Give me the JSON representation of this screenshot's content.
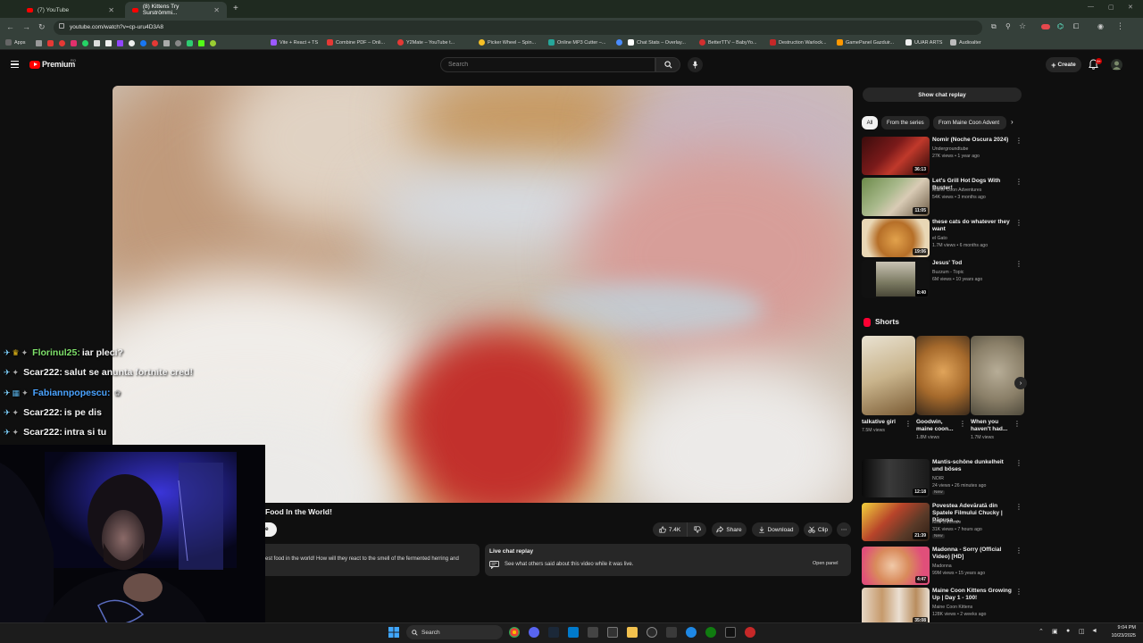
{
  "browser": {
    "tabs": [
      {
        "title": "(7) YouTube"
      },
      {
        "title": "(8) Kittens Try Surströmmi..."
      }
    ],
    "url": "youtube.com/watch?v=cp-uru4D3A8",
    "bookmarks": [
      {
        "label": "Apps",
        "color": "#888"
      },
      {
        "label": "Vite + React + TS",
        "color": "#9b59ff"
      },
      {
        "label": "Combine PDF – Onli...",
        "color": "#e53935"
      },
      {
        "label": "Y2Mate – YouTube t...",
        "color": "#e53935"
      },
      {
        "label": "Picker Wheel – Spin...",
        "color": "#f6c026"
      },
      {
        "label": "Online MP3 Cutter –...",
        "color": "#26a69a"
      },
      {
        "label": "Chat Stats – Overlay...",
        "color": "#ffffff"
      },
      {
        "label": "BetterTTV – BabyYo...",
        "color": "#d32f2f"
      },
      {
        "label": "Destruction Warlock...",
        "color": "#c62828"
      },
      {
        "label": "GamePanel Gazduir...",
        "color": "#ff9800"
      },
      {
        "label": "UUAR ARTS",
        "color": "#eeeeee"
      },
      {
        "label": "Audioalter",
        "color": "#bbbbbb"
      }
    ]
  },
  "header": {
    "logo": "Premium",
    "region": "RO",
    "search_placeholder": "Search",
    "create_label": "Create",
    "notification_count": "9+"
  },
  "video": {
    "title": "Food In the World!",
    "subscribe_fragment": "e",
    "like_count": "7.4K",
    "actions": {
      "share": "Share",
      "download": "Download",
      "clip": "Clip"
    },
    "description_fragment": "est food in the world! How will they react to the smell of the fermented herring and",
    "live_chat": {
      "title": "Live chat replay",
      "subtitle": "See what others said about this video while it was live.",
      "open_panel": "Open panel"
    }
  },
  "sidebar": {
    "show_chat_label": "Show chat replay",
    "chips": [
      "All",
      "From the series",
      "From Maine Coon Advent"
    ],
    "recommendations": [
      {
        "title": "Nomir (Noche Oscura 2024)",
        "channel": "Undergroundtube",
        "meta": "27K views • 1 year ago",
        "duration": "36:13"
      },
      {
        "title": "Let's Grill Hot Dogs With Buster!",
        "channel": "Maine Coon Adventures",
        "meta": "54K views • 3 months ago",
        "duration": "11:05"
      },
      {
        "title": "these cats do whatever they want",
        "channel": "el Gato",
        "meta": "1.7M views • 6 months ago",
        "duration": "19:06"
      },
      {
        "title": "Jesus' Tod",
        "channel": "Buzzum - Topic",
        "meta": "6M views • 10 years ago",
        "duration": "8:40"
      }
    ],
    "shorts_heading": "Shorts",
    "shorts": [
      {
        "title": "talkative girl",
        "views": "7.5M views"
      },
      {
        "title": "Goodwin, maine coon...",
        "views": "1.8M views"
      },
      {
        "title": "When you haven't had...",
        "views": "1.7M views"
      }
    ],
    "more_recommendations": [
      {
        "title": "Mantis-schöne dunkelheit und böses",
        "channel": "NOIR",
        "meta": "24 views • 26 minutes ago",
        "badge": "New",
        "duration": "12:18"
      },
      {
        "title": "Povestea Adevărată din Spatele Filmului Chucky | Păpușa ...",
        "channel": "Mirri criminale",
        "meta": "31K views • 7 hours ago",
        "badge": "New",
        "duration": "21:39"
      },
      {
        "title": "Madonna - Sorry (Official Video) [HD]",
        "channel": "Madonna",
        "meta": "99M views • 15 years ago",
        "duration": "4:47"
      },
      {
        "title": "Maine Coon Kittens Growing Up | Day 1 - 100!",
        "channel": "Maine Coon Kittens",
        "meta": "128K views • 2 weeks ago",
        "duration": "35:08"
      }
    ]
  },
  "stream_chat": [
    {
      "user": "Florinul25:",
      "message": "iar pleci?",
      "color": "#7ee16a"
    },
    {
      "user": "Scar222:",
      "message": "salut se anunta fortnite cred!",
      "color": "#ffffff"
    },
    {
      "user": "Fabiannpopescu:",
      "message": "",
      "color": "#4aa3ff"
    },
    {
      "user": "Scar222:",
      "message": "is pe dis",
      "color": "#ffffff"
    },
    {
      "user": "Scar222:",
      "message": "intra si tu",
      "color": "#ffffff"
    }
  ],
  "taskbar": {
    "search_label": "Search",
    "time": "9:04 PM",
    "date": "10/23/2025"
  },
  "colors": {
    "youtube_red": "#ff0000",
    "bg": "#0f0f0f",
    "surface": "#272727"
  }
}
